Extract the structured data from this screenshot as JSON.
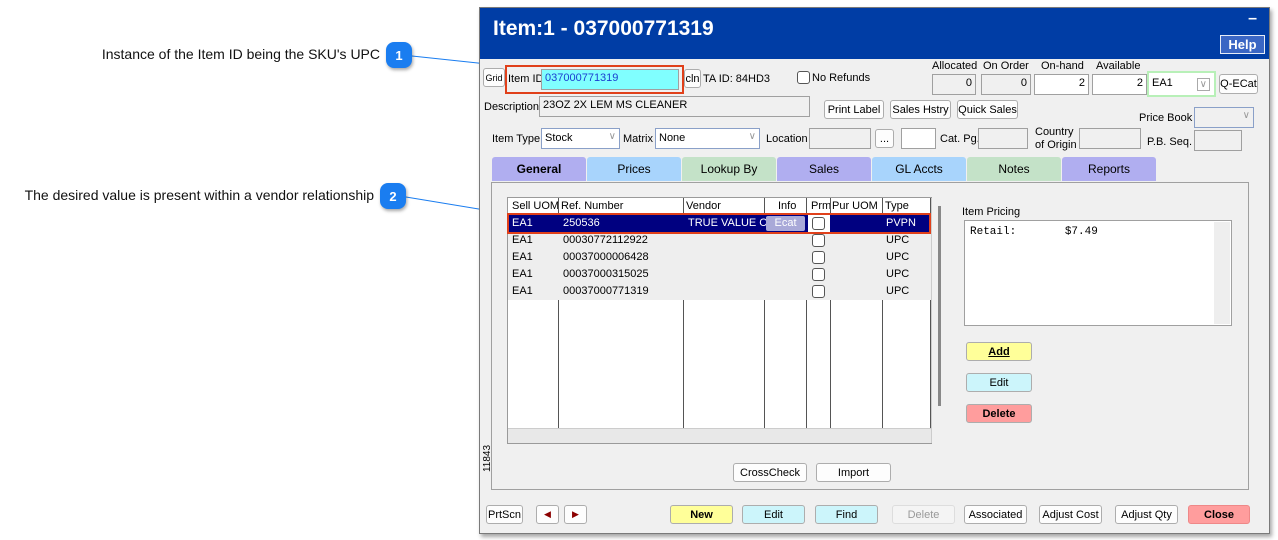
{
  "callouts": [
    {
      "number": "1",
      "text": "Instance of the Item ID being the SKU's UPC"
    },
    {
      "number": "2",
      "text": "The desired value is present within a vendor relationship"
    }
  ],
  "window": {
    "title": "Item:1 - 037000771319",
    "minimize_label": "–",
    "help_label": "Help",
    "side_label": "11843"
  },
  "header": {
    "grid_label": "Grid",
    "item_id_label": "Item ID",
    "item_id_value": "037000771319",
    "cln_label": "cln",
    "ta_id": "TA ID: 84HD3",
    "no_refunds_label": "No Refunds",
    "no_refunds_checked": false,
    "description_label": "Description",
    "description_value": "23OZ 2X LEM MS CLEANER",
    "print_label": "Print Label",
    "sales_history": "Sales Hstry",
    "quick_sales": "Quick Sales",
    "item_type_label": "Item Type",
    "item_type_value": "Stock",
    "matrix_label": "Matrix",
    "matrix_value": "None",
    "location_label": "Location",
    "location_value": "",
    "location_browse": "...",
    "location_extra": "",
    "cat_pg_label": "Cat. Pg.",
    "cat_pg_value": "",
    "country_label_1": "Country",
    "country_label_2": "of Origin",
    "country_value": "",
    "pb_seq_label": "P.B. Seq.",
    "pb_seq_value": "",
    "price_book_label": "Price Book",
    "price_book_value": "",
    "qecat_label": "Q-ECat",
    "uom_value": "EA1",
    "stock": {
      "allocated_label": "Allocated",
      "allocated": "0",
      "on_order_label": "On Order",
      "on_order": "0",
      "on_hand_label": "On-hand",
      "on_hand": "2",
      "available_label": "Available",
      "available": "2"
    }
  },
  "tabs": [
    {
      "label": "General",
      "color": "#b0aef0",
      "active": true
    },
    {
      "label": "Prices",
      "color": "#a8d4fc"
    },
    {
      "label": "Lookup By",
      "color": "#c4e2c8"
    },
    {
      "label": "Sales",
      "color": "#b0aef0"
    },
    {
      "label": "GL Accts",
      "color": "#a8d4fc"
    },
    {
      "label": "Notes",
      "color": "#c4e2c8"
    },
    {
      "label": "Reports",
      "color": "#b0aef0"
    }
  ],
  "grid": {
    "columns": [
      "Sell UOM",
      "Ref. Number",
      "Vendor",
      "Info",
      "Prm",
      "Pur UOM",
      "Type"
    ],
    "rows": [
      {
        "sell_uom": "EA1",
        "ref": "250536",
        "vendor": "TRUE VALUE CO",
        "info": "Ecat",
        "prm": false,
        "pur_uom": "",
        "type": "PVPN",
        "selected": true
      },
      {
        "sell_uom": "EA1",
        "ref": "00030772112922",
        "vendor": "",
        "info": "",
        "prm": false,
        "pur_uom": "",
        "type": "UPC"
      },
      {
        "sell_uom": "EA1",
        "ref": "00037000006428",
        "vendor": "",
        "info": "",
        "prm": false,
        "pur_uom": "",
        "type": "UPC"
      },
      {
        "sell_uom": "EA1",
        "ref": "00037000315025",
        "vendor": "",
        "info": "",
        "prm": false,
        "pur_uom": "",
        "type": "UPC"
      },
      {
        "sell_uom": "EA1",
        "ref": "00037000771319",
        "vendor": "",
        "info": "",
        "prm": false,
        "pur_uom": "",
        "type": "UPC"
      }
    ],
    "crosscheck_label": "CrossCheck",
    "import_label": "Import"
  },
  "pricing": {
    "label": "Item Pricing",
    "retail_label": "Retail:",
    "retail_value": "$7.49",
    "add_label": "Add",
    "edit_label": "Edit",
    "delete_label": "Delete"
  },
  "footer": {
    "prtscn": "PrtScn",
    "prev": "◀",
    "next": "▶",
    "new": "New",
    "edit": "Edit",
    "find": "Find",
    "delete": "Delete",
    "associated": "Associated",
    "adjust_cost": "Adjust Cost",
    "adjust_qty": "Adjust Qty",
    "close": "Close"
  },
  "colors": {
    "title_bar": "#003da5",
    "selected_row": "#000080",
    "item_id_bg": "#80ffff",
    "highlight": "#e0401a",
    "callout": "#1a7df0",
    "yellow_btn": "#ffff99",
    "cyan_btn": "#ccf5fb",
    "red_btn": "#ff9d9d"
  }
}
